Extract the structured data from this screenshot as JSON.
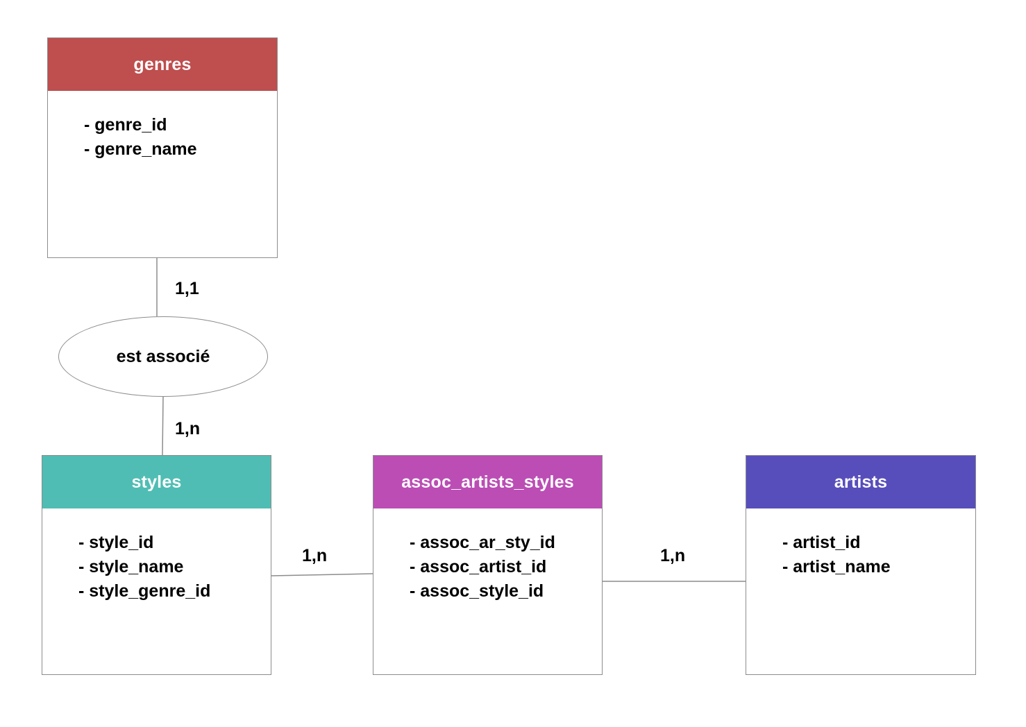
{
  "entities": {
    "genres": {
      "title": "genres",
      "color": "#bf4e4e",
      "attributes": [
        "- genre_id",
        "- genre_name"
      ]
    },
    "styles": {
      "title": "styles",
      "color": "#4fbdb3",
      "attributes": [
        "- style_id",
        "- style_name",
        "- style_genre_id"
      ]
    },
    "assoc": {
      "title": "assoc_artists_styles",
      "color": "#bb4db5",
      "attributes": [
        "- assoc_ar_sty_id",
        "- assoc_artist_id",
        "- assoc_style_id"
      ]
    },
    "artists": {
      "title": "artists",
      "color": "#574ebb",
      "attributes": [
        "- artist_id",
        "- artist_name"
      ]
    }
  },
  "relation": {
    "label": "est associé"
  },
  "cardinalities": {
    "genres_relation": "1,1",
    "relation_styles": "1,n",
    "styles_assoc": "1,n",
    "assoc_artists": "1,n"
  }
}
